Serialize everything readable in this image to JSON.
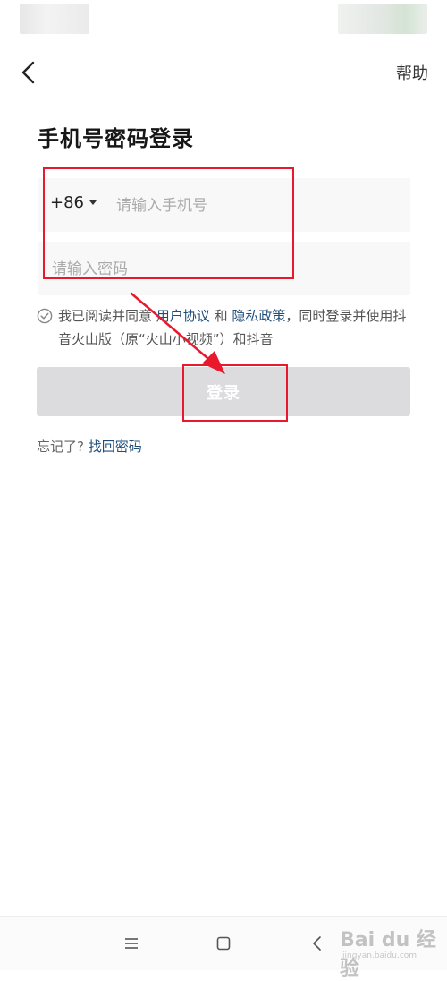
{
  "header": {
    "help_label": "帮助"
  },
  "title": "手机号密码登录",
  "phone": {
    "country_code": "+86",
    "placeholder": "请输入手机号",
    "value": ""
  },
  "password": {
    "placeholder": "请输入密码",
    "value": ""
  },
  "agreement": {
    "prefix": "我已阅读并同意 ",
    "user_agreement": "用户协议",
    "and": " 和 ",
    "privacy_policy": "隐私政策",
    "suffix": "，同时登录并使用抖音火山版（原“火山小视频”）和抖音"
  },
  "login_button": {
    "label": "登录"
  },
  "forgot": {
    "prefix": "忘记了? ",
    "link": "找回密码"
  },
  "watermark": {
    "logo": "Bai du 经验",
    "url": "jingyan.baidu.com"
  },
  "icons": {
    "back": "chevron-left-icon",
    "check": "check-circle-icon",
    "menu": "menu-icon",
    "home": "home-square-icon",
    "nav_back": "back-icon"
  },
  "colors": {
    "annotation": "#e8192c",
    "link": "#1f4d7a",
    "button_disabled": "#dcdcde"
  }
}
